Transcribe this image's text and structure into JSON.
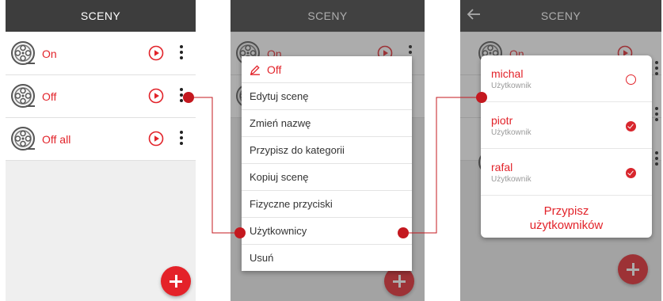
{
  "screen1": {
    "title": "SCENY",
    "scenes": [
      {
        "label": "On"
      },
      {
        "label": "Off"
      },
      {
        "label": "Off all"
      }
    ]
  },
  "screen2": {
    "title": "SCENY",
    "bg_scenes": [
      {
        "label": "On"
      }
    ],
    "menu": {
      "title": "Off",
      "items": [
        "Edytuj scenę",
        "Zmień nazwę",
        "Przypisz do kategorii",
        "Kopiuj scenę",
        "Fizyczne przyciski",
        "Użytkownicy",
        "Usuń"
      ]
    }
  },
  "screen3": {
    "title": "SCENY",
    "bg_scenes": [
      {
        "label": "On"
      }
    ],
    "users": [
      {
        "name": "michal",
        "role": "Użytkownik",
        "selected": false
      },
      {
        "name": "piotr",
        "role": "Użytkownik",
        "selected": true
      },
      {
        "name": "rafal",
        "role": "Użytkownik",
        "selected": true
      }
    ],
    "assign_label_line1": "Przypisz",
    "assign_label_line2": "użytkowników"
  },
  "colors": {
    "accent": "#e2232a",
    "appbar": "#3d3d3d",
    "callout": "#c4181f"
  },
  "icons": [
    "film-reel-icon",
    "play-circle-icon",
    "more-vert-icon",
    "add-icon",
    "pencil-icon",
    "back-arrow-icon",
    "check-icon"
  ]
}
